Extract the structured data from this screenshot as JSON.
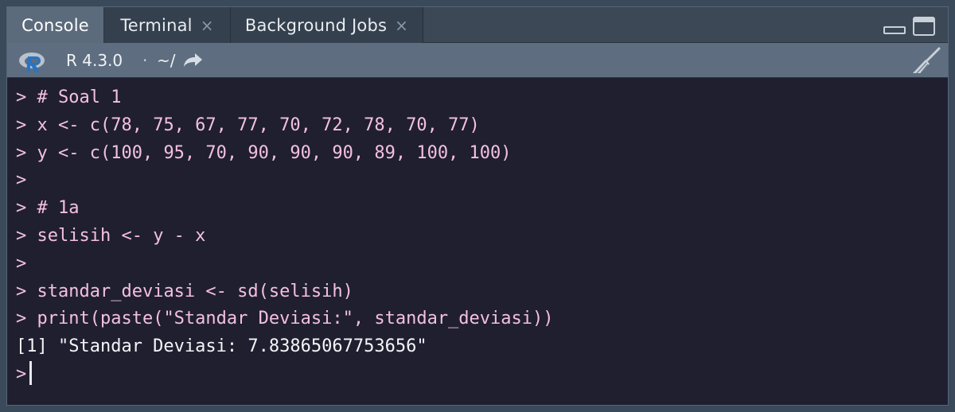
{
  "tabs": [
    {
      "label": "Console",
      "closable": false,
      "active": true
    },
    {
      "label": "Terminal",
      "closable": true,
      "close_glyph": "×"
    },
    {
      "label": "Background Jobs",
      "closable": true,
      "close_glyph": "×"
    }
  ],
  "toolbar": {
    "r_version": "R 4.3.0",
    "separator": "·",
    "working_dir": "~/",
    "icons": [
      "r-logo-icon",
      "goto-directory-icon",
      "clear-console-broom-icon"
    ]
  },
  "console": {
    "prompt": ">",
    "lines": [
      {
        "type": "input",
        "text": "# Soal 1"
      },
      {
        "type": "input",
        "text": "x <- c(78, 75, 67, 77, 70, 72, 78, 70, 77)"
      },
      {
        "type": "input",
        "text": "y <- c(100, 95, 70, 90, 90, 90, 89, 100, 100)"
      },
      {
        "type": "input",
        "text": ""
      },
      {
        "type": "input",
        "text": "# 1a"
      },
      {
        "type": "input",
        "text": "selisih <- y - x"
      },
      {
        "type": "input",
        "text": ""
      },
      {
        "type": "input",
        "text": "standar_deviasi <- sd(selisih)"
      },
      {
        "type": "input",
        "text": "print(paste(\"Standar Deviasi:\", standar_deviasi))"
      },
      {
        "type": "output",
        "text": "[1] \"Standar Deviasi: 7.83865067753656\""
      }
    ]
  },
  "colors": {
    "console_bg": "#1f1f2f",
    "input_text": "#f3c0e0",
    "output_text": "#f4f4f8",
    "tab_active_bg": "#5b6b7c",
    "toolbar_bg": "#5e6e80"
  }
}
